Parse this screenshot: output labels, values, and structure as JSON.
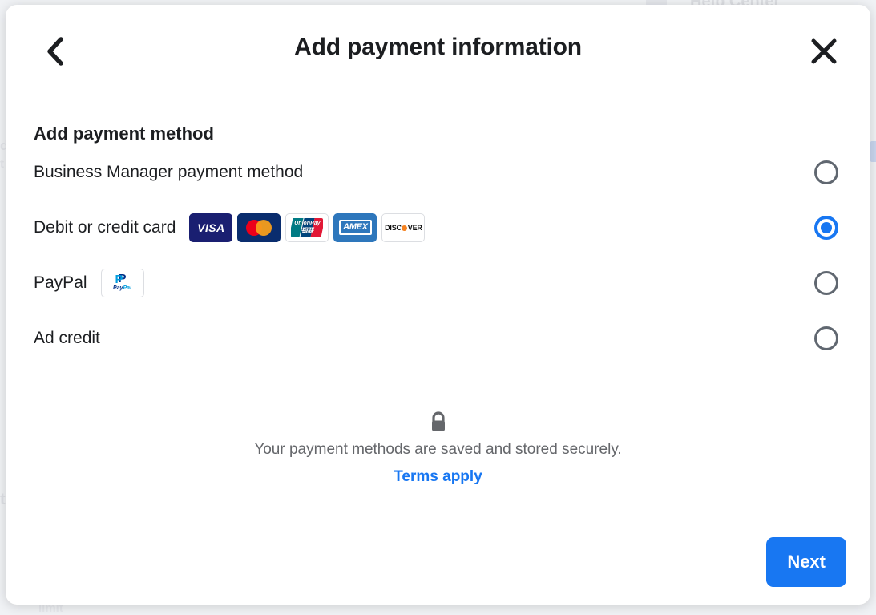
{
  "background": {
    "help_center": "Help Center",
    "left_fragments": [
      "d",
      "t",
      "t",
      "limit"
    ]
  },
  "dialog": {
    "title": "Add payment information",
    "back_icon": "chevron-left-icon",
    "close_icon": "close-icon",
    "section_heading": "Add payment method",
    "options": [
      {
        "label": "Business Manager payment method",
        "selected": false,
        "brands": []
      },
      {
        "label": "Debit or credit card",
        "selected": true,
        "brands": [
          "visa",
          "mastercard",
          "unionpay",
          "amex",
          "discover"
        ]
      },
      {
        "label": "PayPal",
        "selected": false,
        "brands": [
          "paypal"
        ]
      },
      {
        "label": "Ad credit",
        "selected": false,
        "brands": []
      }
    ],
    "secure": {
      "lock_icon": "lock-icon",
      "text": "Your payment methods are saved and stored securely.",
      "terms_link": "Terms apply"
    },
    "footer": {
      "next_label": "Next"
    }
  },
  "brand_labels": {
    "visa": "VISA",
    "amex": "AMEX",
    "discover_pre": "DISC",
    "discover_post": "VER",
    "unionpay_en": "UnionPay",
    "unionpay_cn": "银联",
    "paypal_word_a": "Pay",
    "paypal_word_b": "Pal",
    "paypal_mark": "P"
  },
  "colors": {
    "accent": "#1877f2",
    "text": "#1c1e21",
    "muted": "#65676b",
    "page_bg": "#f0f2f5",
    "visa": "#1a1f71",
    "mastercard_bg": "#0a2d6e",
    "mastercard_red": "#eb001b",
    "mastercard_orange": "#f79e1b",
    "amex": "#2e77bc",
    "discover_orange": "#f58220",
    "paypal_dark": "#003087",
    "paypal_light": "#009cde"
  }
}
